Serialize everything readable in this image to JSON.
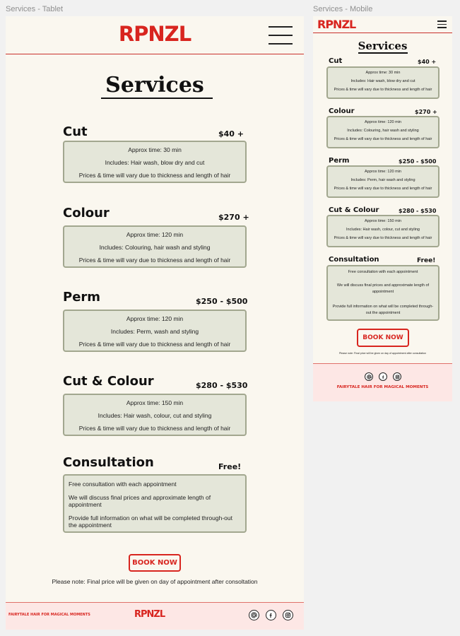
{
  "frames": {
    "tablet_label": "Services - Tablet",
    "mobile_label": "Services - Mobile"
  },
  "brand": {
    "logo": "RPNZL",
    "tagline": "FAIRYTALE HAIR FOR MAGICAL MOMENTS",
    "accent_color": "#d8251f",
    "card_color": "#e4e6d9",
    "card_border_color": "#a2a78f",
    "footer_color": "#fde7e5"
  },
  "page": {
    "title": "Services",
    "book_label": "BOOK NOW",
    "note": "Please note: Final price will be given on day of appointment after consoltation"
  },
  "services": [
    {
      "name": "Cut",
      "price": "$40 +",
      "lines": [
        "Approx time: 30 min",
        "Includes: Hair wash, blow dry and cut",
        "Prices & time will vary due to thickness and length of hair"
      ]
    },
    {
      "name": "Colour",
      "price": "$270 +",
      "lines": [
        "Approx time: 120 min",
        "Includes: Colouring, hair wash and styling",
        "Prices & time will vary due to thickness and length of hair"
      ]
    },
    {
      "name": "Perm",
      "price": "$250 - $500",
      "lines": [
        "Approx time: 120 min",
        "Includes: Perm, wash and styling",
        "Prices & time will vary due to thickness and length of hair"
      ]
    },
    {
      "name": "Cut & Colour",
      "price": "$280 - $530",
      "lines": [
        "Approx time: 150 min",
        "Includes: Hair wash, colour, cut and styling",
        "Prices & time will vary due to thickness and length of hair"
      ]
    },
    {
      "name": "Consultation",
      "price": "Free!",
      "lines": [
        "Free consultation with each appointment",
        "We will discuss final prices and approximate length of appointment",
        "Provide full information on what will be completed through-out the appointment"
      ]
    }
  ],
  "mobile": {
    "services": [
      {
        "lines": [
          "Approx time: 30 min",
          "Includes: Hair wash, blow dry and cut",
          "Prices & time will vary due to thickness and length of hair"
        ]
      },
      {
        "lines": [
          "Approx time: 120 min",
          "Includes: Colouring, hair wash and styling",
          "Prices & time will vary due to thickness and length of hair"
        ]
      },
      {
        "lines": [
          "Approx time: 120 min",
          "Includes: Perm, hair wash and styling",
          "Prices & time will vary due to thickness and length of hair"
        ]
      },
      {
        "lines": [
          "Approx time: 150 min",
          "Includes: Hair wash, colour, cut and styling",
          "Prices & time will vary due to thickness and length of hair"
        ]
      },
      {
        "lines": [
          "Free consultation with each appointment",
          "We will discuss final prices and approximate length of appointment",
          "Provide full information on what will be completed through-out the appointment"
        ]
      }
    ],
    "note": "Please note: Final price will be given on day of appointment after consultation"
  },
  "icons": {
    "menu": "hamburger-menu-icon",
    "social": [
      "threads-icon",
      "facebook-icon",
      "instagram-icon"
    ]
  }
}
